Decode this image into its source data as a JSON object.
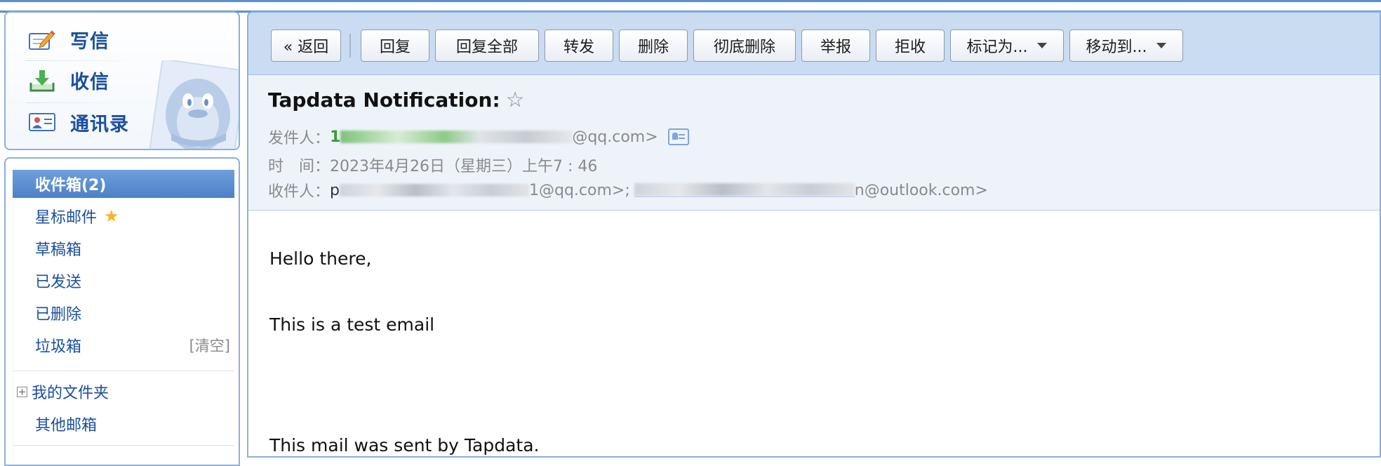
{
  "quick": {
    "compose_label": "写信",
    "inbox_label": "收信",
    "contacts_label": "通讯录"
  },
  "folders": {
    "inbox_label": "收件箱(2)",
    "starred_label": "星标邮件",
    "drafts_label": "草稿箱",
    "sent_label": "已发送",
    "deleted_label": "已删除",
    "spam_label": "垃圾箱",
    "spam_clear_label": "[清空]",
    "my_folders_label": "我的文件夹",
    "other_mailboxes_label": "其他邮箱"
  },
  "toolbar": {
    "back_label": "« 返回",
    "reply_label": "回复",
    "reply_all_label": "回复全部",
    "forward_label": "转发",
    "delete_label": "删除",
    "delete_permanently_label": "彻底删除",
    "report_label": "举报",
    "reject_label": "拒收",
    "mark_as_label": "标记为...",
    "move_to_label": "移动到..."
  },
  "message": {
    "subject": "Tapdata Notification:",
    "star_glyph": "☆",
    "from_label": "发件人：",
    "from_initial": "1",
    "from_domain": "@qq.com>",
    "time_label": "时　间：",
    "time_value": "2023年4月26日（星期三）上午7 : 46",
    "to_label": "收件人：",
    "to_first_initial": "p",
    "to_first_suffix": "1@qq.com>;",
    "to_second_suffix": "n@outlook.com>",
    "body": {
      "greeting": "Hello there,",
      "line1": "This is a test email",
      "footer": "This mail was sent by Tapdata."
    }
  },
  "colors": {
    "accent": "#1a4f9c",
    "selected_folder": "#5a8dd0",
    "toolbar_bg": "#c9dcf1",
    "header_bg": "#eef3f9",
    "star": "#f5b425"
  },
  "icons": {
    "compose": "pencil-paper-icon",
    "inbox": "download-tray-icon",
    "contacts": "contact-card-icon",
    "sender_card": "contact-card-icon"
  }
}
